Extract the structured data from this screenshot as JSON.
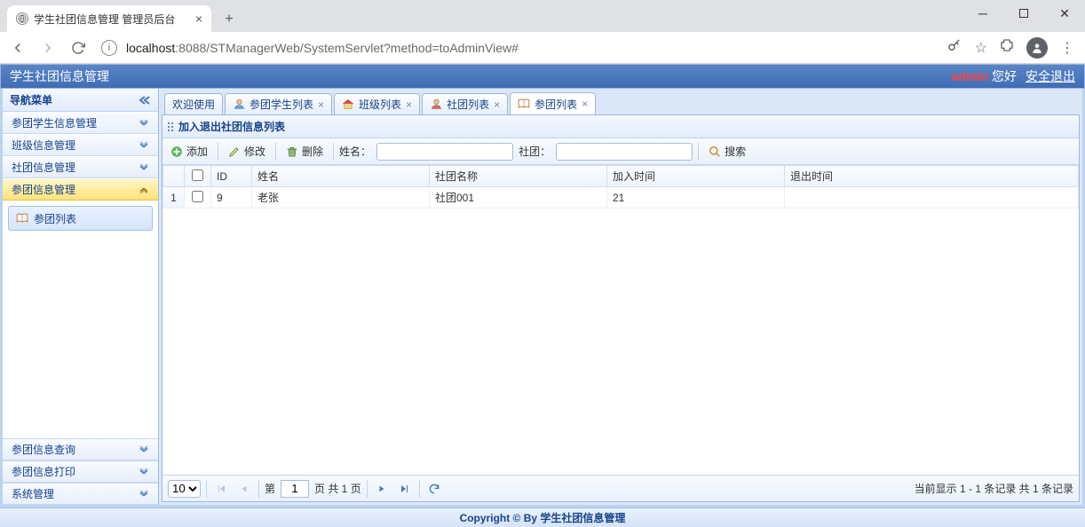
{
  "browser": {
    "tab_title": "学生社团信息管理 管理员后台",
    "url_host": "localhost",
    "url_port_path": ":8088/STManagerWeb/SystemServlet?method=toAdminView#"
  },
  "header": {
    "title": "学生社团信息管理",
    "user": "admin",
    "greet": "您好",
    "logout": "安全退出"
  },
  "sidebar": {
    "title": "导航菜单",
    "top_items": [
      {
        "label": "参团学生信息管理"
      },
      {
        "label": "班级信息管理"
      },
      {
        "label": "社团信息管理"
      },
      {
        "label": "参团信息管理",
        "active": true
      }
    ],
    "sub_item": "参团列表",
    "bottom_items": [
      {
        "label": "参团信息查询"
      },
      {
        "label": "参团信息打印"
      },
      {
        "label": "系统管理"
      }
    ]
  },
  "tabs": [
    {
      "label": "欢迎使用",
      "closeable": false
    },
    {
      "label": "参团学生列表",
      "closeable": true
    },
    {
      "label": "班级列表",
      "closeable": true
    },
    {
      "label": "社团列表",
      "closeable": true
    },
    {
      "label": "参团列表",
      "closeable": true,
      "active": true
    }
  ],
  "panel": {
    "title": "加入退出社团信息列表",
    "toolbar": {
      "add": "添加",
      "edit": "修改",
      "del": "删除",
      "name_label": "姓名：",
      "club_label": "社团：",
      "search": "搜索"
    },
    "columns": {
      "id": "ID",
      "name": "姓名",
      "club": "社团名称",
      "join": "加入时间",
      "quit": "退出时间"
    },
    "rows": [
      {
        "idx": "1",
        "id": "9",
        "name": "老张",
        "club": "社团001",
        "join": "21",
        "quit": ""
      }
    ]
  },
  "pager": {
    "size": "10",
    "page_prefix": "第",
    "page": "1",
    "page_suffix": "页 共 1 页",
    "info": "当前显示 1 - 1 条记录 共 1 条记录"
  },
  "footer": "Copyright © By 学生社团信息管理"
}
